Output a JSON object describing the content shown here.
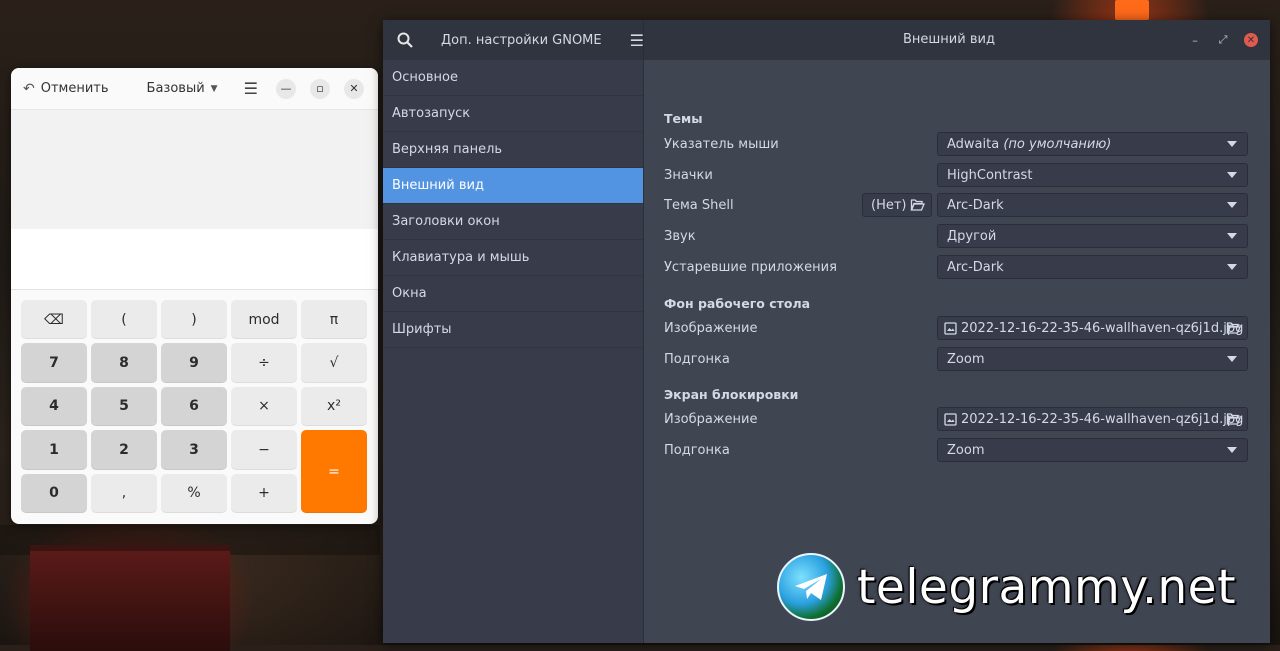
{
  "calculator": {
    "undo_label": "Отменить",
    "mode_label": "Базовый",
    "keys": [
      {
        "label": "⌫",
        "kind": "op"
      },
      {
        "label": "(",
        "kind": "op"
      },
      {
        "label": ")",
        "kind": "op"
      },
      {
        "label": "mod",
        "kind": "op"
      },
      {
        "label": "π",
        "kind": "op"
      },
      {
        "label": "7",
        "kind": "num"
      },
      {
        "label": "8",
        "kind": "num"
      },
      {
        "label": "9",
        "kind": "num"
      },
      {
        "label": "÷",
        "kind": "op"
      },
      {
        "label": "√",
        "kind": "op"
      },
      {
        "label": "4",
        "kind": "num"
      },
      {
        "label": "5",
        "kind": "num"
      },
      {
        "label": "6",
        "kind": "num"
      },
      {
        "label": "×",
        "kind": "op"
      },
      {
        "label": "x²",
        "kind": "op"
      },
      {
        "label": "1",
        "kind": "num"
      },
      {
        "label": "2",
        "kind": "num"
      },
      {
        "label": "3",
        "kind": "num"
      },
      {
        "label": "−",
        "kind": "op"
      },
      {
        "label": "=",
        "kind": "eq"
      },
      {
        "label": "0",
        "kind": "num"
      },
      {
        "label": ",",
        "kind": "op"
      },
      {
        "label": "%",
        "kind": "op"
      },
      {
        "label": "+",
        "kind": "op"
      }
    ]
  },
  "tweaks": {
    "app_title": "Доп. настройки GNOME",
    "page_title": "Внешний вид",
    "sidebar": [
      {
        "label": "Основное"
      },
      {
        "label": "Автозапуск"
      },
      {
        "label": "Верхняя панель"
      },
      {
        "label": "Внешний вид",
        "active": true
      },
      {
        "label": "Заголовки окон"
      },
      {
        "label": "Клавиатура и мышь"
      },
      {
        "label": "Окна"
      },
      {
        "label": "Шрифты"
      }
    ],
    "themes": {
      "heading": "Темы",
      "cursor_label": "Указатель мыши",
      "cursor_value": "Adwaita",
      "cursor_default": "(по умолчанию)",
      "icons_label": "Значки",
      "icons_value": "HighContrast",
      "shell_label": "Тема Shell",
      "shell_none": "(Нет)",
      "shell_value": "Arc-Dark",
      "sound_label": "Звук",
      "sound_value": "Другой",
      "legacy_label": "Устаревшие приложения",
      "legacy_value": "Arc-Dark"
    },
    "background": {
      "heading": "Фон рабочего стола",
      "image_label": "Изображение",
      "image_value": "2022-12-16-22-35-46-wallhaven-qz6j1d.jpg",
      "fit_label": "Подгонка",
      "fit_value": "Zoom"
    },
    "lockscreen": {
      "heading": "Экран блокировки",
      "image_label": "Изображение",
      "image_value": "2022-12-16-22-35-46-wallhaven-qz6j1d.jpg",
      "fit_label": "Подгонка",
      "fit_value": "Zoom"
    }
  },
  "watermark": {
    "text": "telegrammy.net"
  },
  "colors": {
    "accent": "#5294e2",
    "calc_equals": "#ff7800",
    "close": "#e05b4d"
  }
}
